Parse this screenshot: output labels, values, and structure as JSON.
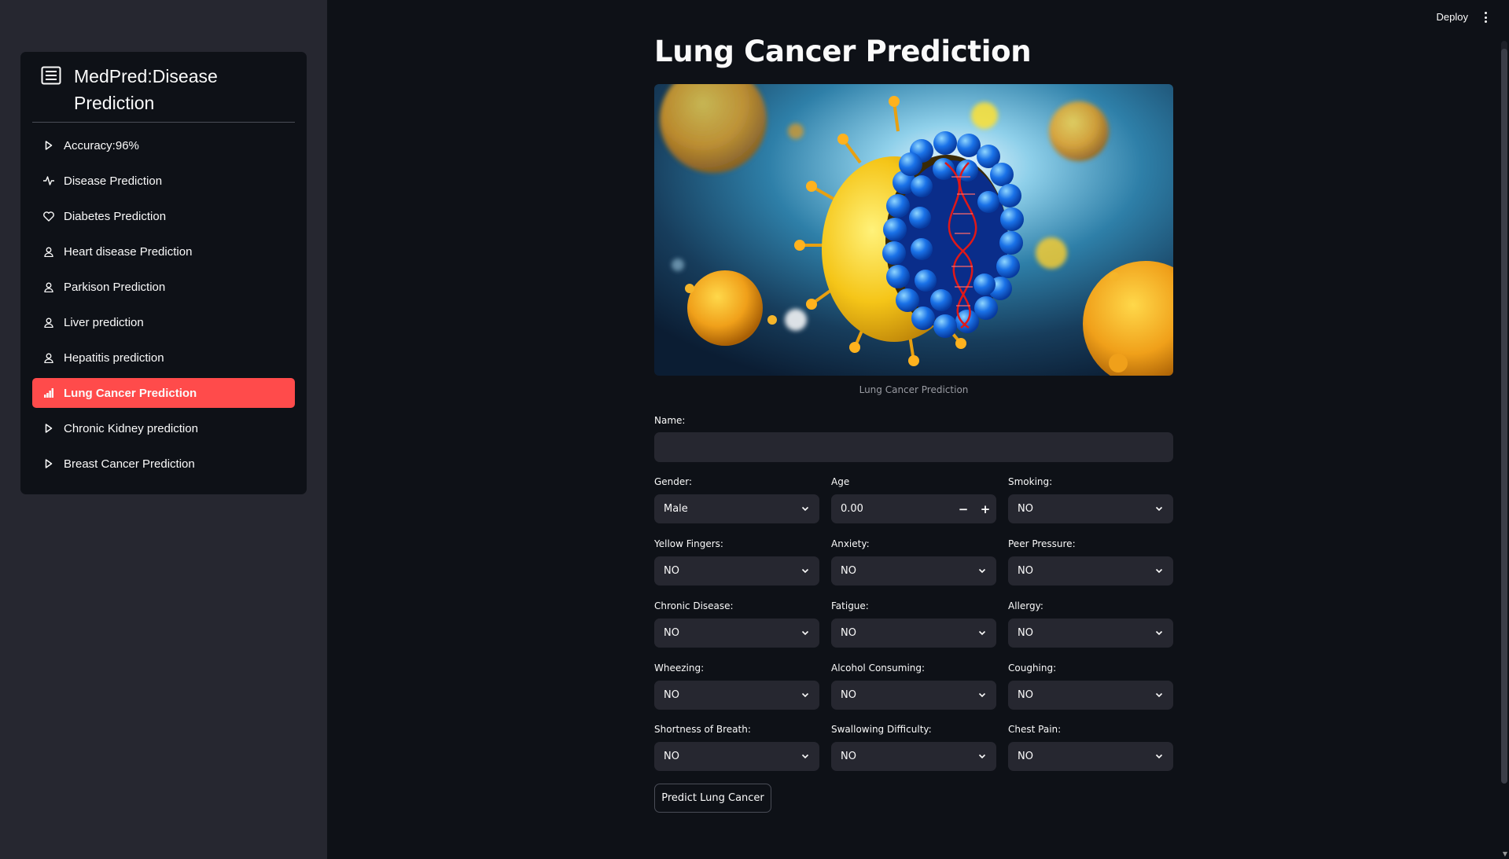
{
  "sidebar": {
    "title": "MedPred:Disease Prediction",
    "items": [
      {
        "label": "Accuracy:96%",
        "icon": "play-icon"
      },
      {
        "label": "Disease Prediction",
        "icon": "activity-icon"
      },
      {
        "label": "Diabetes Prediction",
        "icon": "heart-icon"
      },
      {
        "label": "Heart disease Prediction",
        "icon": "person-icon"
      },
      {
        "label": "Parkison Prediction",
        "icon": "person-icon"
      },
      {
        "label": "Liver prediction",
        "icon": "person-icon"
      },
      {
        "label": "Hepatitis prediction",
        "icon": "person-icon"
      },
      {
        "label": "Lung Cancer Prediction",
        "icon": "bar-chart-icon",
        "active": true
      },
      {
        "label": "Chronic Kidney prediction",
        "icon": "play-icon"
      },
      {
        "label": "Breast Cancer Prediction",
        "icon": "play-icon"
      }
    ]
  },
  "header": {
    "deploy_label": "Deploy"
  },
  "main": {
    "title": "Lung Cancer Prediction",
    "image_caption": "Lung Cancer Prediction",
    "name_label": "Name:",
    "name_value": "",
    "gender": {
      "label": "Gender:",
      "value": "Male"
    },
    "age": {
      "label": "Age",
      "value": "0.00",
      "minus": "−",
      "plus": "+"
    },
    "fields": [
      {
        "label": "Smoking:",
        "value": "NO"
      },
      {
        "label": "Yellow Fingers:",
        "value": "NO"
      },
      {
        "label": "Anxiety:",
        "value": "NO"
      },
      {
        "label": "Peer Pressure:",
        "value": "NO"
      },
      {
        "label": "Chronic Disease:",
        "value": "NO"
      },
      {
        "label": "Fatigue:",
        "value": "NO"
      },
      {
        "label": "Allergy:",
        "value": "NO"
      },
      {
        "label": "Wheezing:",
        "value": "NO"
      },
      {
        "label": "Alcohol Consuming:",
        "value": "NO"
      },
      {
        "label": "Coughing:",
        "value": "NO"
      },
      {
        "label": "Shortness of Breath:",
        "value": "NO"
      },
      {
        "label": "Swallowing Difficulty:",
        "value": "NO"
      },
      {
        "label": "Chest Pain:",
        "value": "NO"
      }
    ],
    "predict_button": "Predict Lung Cancer"
  },
  "colors": {
    "accent": "#ff4b4b",
    "background": "#0e1117",
    "sidebar": "#262730"
  }
}
